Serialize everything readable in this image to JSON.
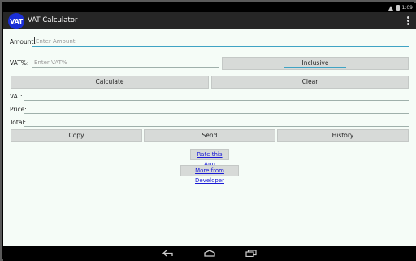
{
  "status_bar": {
    "time": "1:09"
  },
  "action_bar": {
    "icon_text": "VAT",
    "title": "VAT Calculator"
  },
  "form": {
    "amount_label": "Amount:",
    "amount_placeholder": "Enter Amount",
    "vat_label": "VAT%:",
    "vat_placeholder": "Enter VAT%",
    "inclusive_label": "Inclusive",
    "calculate_label": "Calculate",
    "clear_label": "Clear"
  },
  "results": {
    "vat_label": "VAT:",
    "vat_value": "",
    "price_label": "Price:",
    "price_value": "",
    "total_label": "Total:",
    "total_value": ""
  },
  "actions": {
    "copy_label": "Copy",
    "send_label": "Send",
    "history_label": "History"
  },
  "links": {
    "rate_label": "Rate this App",
    "more_label": "More from Developer"
  },
  "colors": {
    "accent": "#3fa3c4",
    "icon_bg": "#1b2fd6",
    "background": "#f5fcf7"
  }
}
